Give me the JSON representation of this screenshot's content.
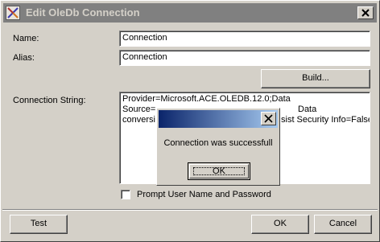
{
  "window": {
    "title": "Edit OleDb Connection"
  },
  "form": {
    "name_label": "Name:",
    "name_value": "Connection",
    "alias_label": "Alias:",
    "alias_value": "Connection",
    "build_label": "Build...",
    "connection_string_label": "Connection String:",
    "connection_string_lines": [
      "Provider=Microsoft.ACE.OLEDB.12.0;Data",
      "Source=",
      "conversi"
    ],
    "connection_string_visible_fragments": [
      "Data",
      "sist Security Info=False"
    ],
    "prompt_checkbox_label": "Prompt User Name and Password",
    "prompt_checkbox_checked": false
  },
  "buttons": {
    "test": "Test",
    "ok": "OK",
    "cancel": "Cancel"
  },
  "message_box": {
    "title": "",
    "message": "Connection was successfull",
    "ok": "OK"
  }
}
